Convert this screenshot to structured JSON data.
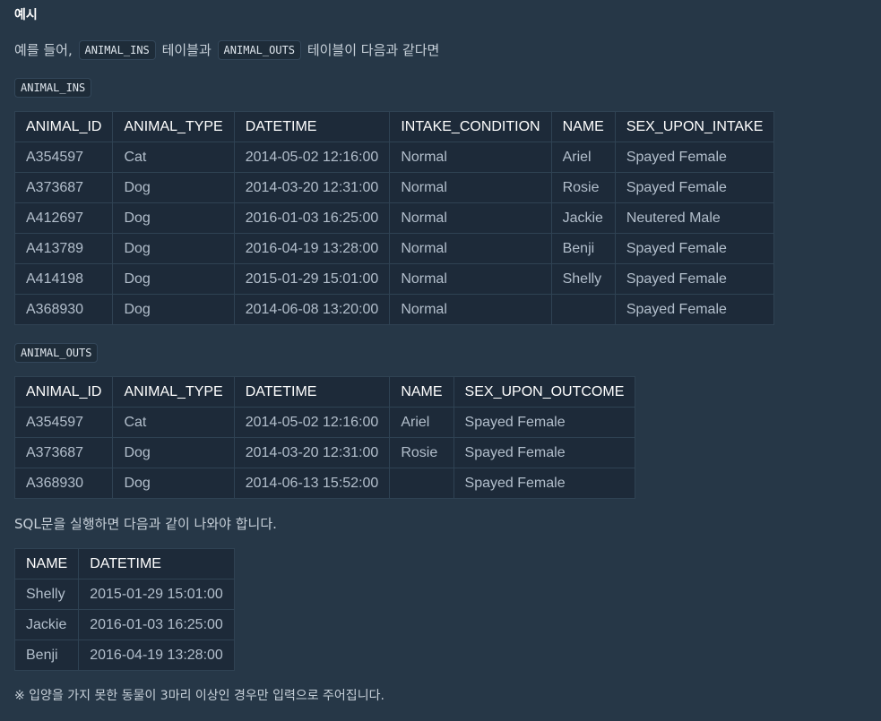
{
  "heading": "예시",
  "intro": {
    "prefix": "예를 들어,",
    "code1": "ANIMAL_INS",
    "mid": "테이블과",
    "code2": "ANIMAL_OUTS",
    "suffix": "테이블이 다음과 같다면"
  },
  "ins": {
    "label": "ANIMAL_INS",
    "headers": [
      "ANIMAL_ID",
      "ANIMAL_TYPE",
      "DATETIME",
      "INTAKE_CONDITION",
      "NAME",
      "SEX_UPON_INTAKE"
    ],
    "rows": [
      [
        "A354597",
        "Cat",
        "2014-05-02 12:16:00",
        "Normal",
        "Ariel",
        "Spayed Female"
      ],
      [
        "A373687",
        "Dog",
        "2014-03-20 12:31:00",
        "Normal",
        "Rosie",
        "Spayed Female"
      ],
      [
        "A412697",
        "Dog",
        "2016-01-03 16:25:00",
        "Normal",
        "Jackie",
        "Neutered Male"
      ],
      [
        "A413789",
        "Dog",
        "2016-04-19 13:28:00",
        "Normal",
        "Benji",
        "Spayed Female"
      ],
      [
        "A414198",
        "Dog",
        "2015-01-29 15:01:00",
        "Normal",
        "Shelly",
        "Spayed Female"
      ],
      [
        "A368930",
        "Dog",
        "2014-06-08 13:20:00",
        "Normal",
        "",
        "Spayed Female"
      ]
    ]
  },
  "outs": {
    "label": "ANIMAL_OUTS",
    "headers": [
      "ANIMAL_ID",
      "ANIMAL_TYPE",
      "DATETIME",
      "NAME",
      "SEX_UPON_OUTCOME"
    ],
    "rows": [
      [
        "A354597",
        "Cat",
        "2014-05-02 12:16:00",
        "Ariel",
        "Spayed Female"
      ],
      [
        "A373687",
        "Dog",
        "2014-03-20 12:31:00",
        "Rosie",
        "Spayed Female"
      ],
      [
        "A368930",
        "Dog",
        "2014-06-13 15:52:00",
        "",
        "Spayed Female"
      ]
    ]
  },
  "result_text": "SQL문을 실행하면 다음과 같이 나와야 합니다.",
  "result": {
    "headers": [
      "NAME",
      "DATETIME"
    ],
    "rows": [
      [
        "Shelly",
        "2015-01-29 15:01:00"
      ],
      [
        "Jackie",
        "2016-01-03 16:25:00"
      ],
      [
        "Benji",
        "2016-04-19 13:28:00"
      ]
    ]
  },
  "footnote": "※ 입양을 가지 못한 동물이 3마리 이상인 경우만 입력으로 주어집니다."
}
